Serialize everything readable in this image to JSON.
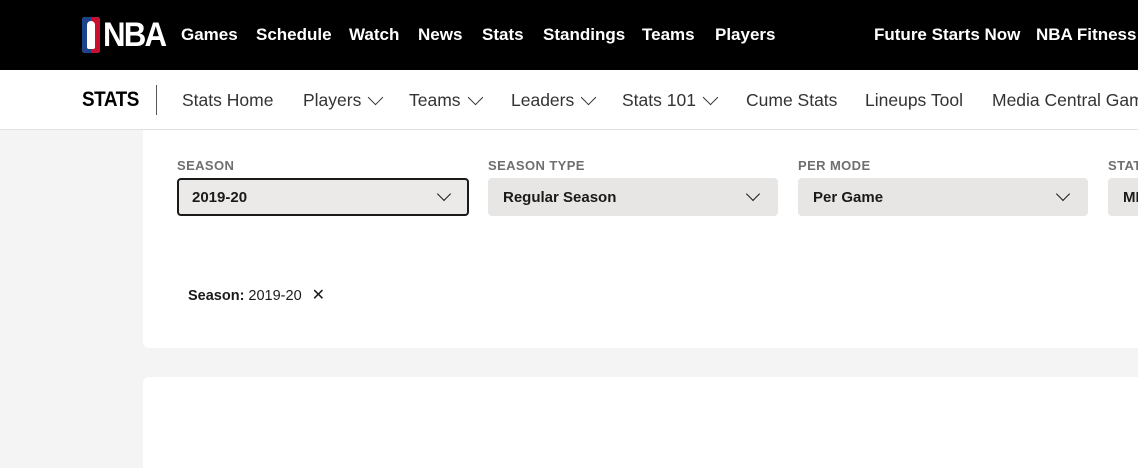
{
  "topnav": {
    "brand": "NBA",
    "links": [
      "Games",
      "Schedule",
      "Watch",
      "News",
      "Stats",
      "Standings",
      "Teams",
      "Players"
    ],
    "right_links": [
      "Future Starts Now",
      "NBA Fitness"
    ]
  },
  "subnav": {
    "title": "STATS",
    "items": [
      {
        "label": "Stats Home",
        "dropdown": false
      },
      {
        "label": "Players",
        "dropdown": true
      },
      {
        "label": "Teams",
        "dropdown": true
      },
      {
        "label": "Leaders",
        "dropdown": true
      },
      {
        "label": "Stats 101",
        "dropdown": true
      },
      {
        "label": "Cume Stats",
        "dropdown": false
      },
      {
        "label": "Lineups Tool",
        "dropdown": false
      },
      {
        "label": "Media Central Gam",
        "dropdown": false
      }
    ]
  },
  "filters": [
    {
      "label": "SEASON",
      "value": "2019-20",
      "active": true
    },
    {
      "label": "SEASON TYPE",
      "value": "Regular Season",
      "active": false
    },
    {
      "label": "PER MODE",
      "value": "Per Game",
      "active": false
    },
    {
      "label": "STAT",
      "value": "MI",
      "active": false
    }
  ],
  "active_filter": {
    "key": "Season:",
    "value": "2019-20",
    "remove_icon": "close-icon"
  },
  "icons": {
    "dropdown": "chevron-down-icon",
    "remove": "close-icon"
  },
  "colors": {
    "nav_bg": "#000000",
    "select_bg": "#e8e6e4",
    "page_bg": "#f4f4f4",
    "nba_blue": "#1d428a",
    "nba_red": "#c8102e"
  }
}
